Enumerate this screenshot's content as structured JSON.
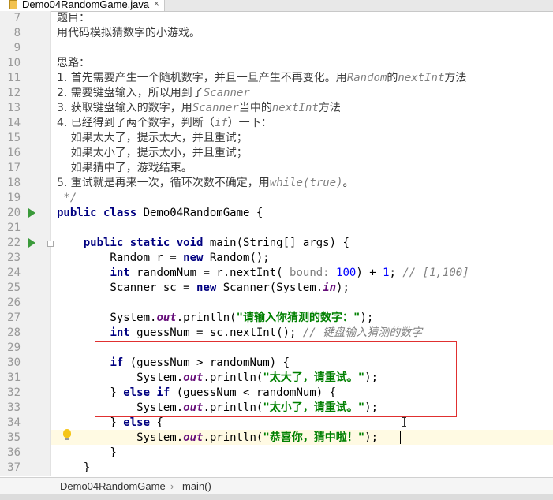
{
  "tab": {
    "label": "Demo04RandomGame.java",
    "close": "×"
  },
  "breadcrumb": {
    "class_name": "Demo04RandomGame",
    "method_name": "main()",
    "separator": "›"
  },
  "lines": [
    {
      "n": "7",
      "parts": [
        {
          "t": "题目：",
          "c": "doc"
        }
      ]
    },
    {
      "n": "8",
      "parts": [
        {
          "t": "用代码模拟猜数字的小游戏。",
          "c": "doc"
        }
      ]
    },
    {
      "n": "9",
      "parts": []
    },
    {
      "n": "10",
      "parts": [
        {
          "t": "思路：",
          "c": "doc"
        }
      ]
    },
    {
      "n": "11",
      "parts": [
        {
          "t": "1. 首先需要产生一个随机数字，并且一旦产生不再变化。用",
          "c": "doc"
        },
        {
          "t": "Random",
          "c": "comment"
        },
        {
          "t": "的",
          "c": "doc"
        },
        {
          "t": "nextInt",
          "c": "comment"
        },
        {
          "t": "方法",
          "c": "doc"
        }
      ]
    },
    {
      "n": "12",
      "parts": [
        {
          "t": "2. 需要键盘输入，所以用到了",
          "c": "doc"
        },
        {
          "t": "Scanner",
          "c": "comment"
        }
      ]
    },
    {
      "n": "13",
      "parts": [
        {
          "t": "3. 获取键盘输入的数字，用",
          "c": "doc"
        },
        {
          "t": "Scanner",
          "c": "comment"
        },
        {
          "t": "当中的",
          "c": "doc"
        },
        {
          "t": "nextInt",
          "c": "comment"
        },
        {
          "t": "方法",
          "c": "doc"
        }
      ]
    },
    {
      "n": "14",
      "parts": [
        {
          "t": "4. 已经得到了两个数字，判断（",
          "c": "doc"
        },
        {
          "t": "if",
          "c": "comment"
        },
        {
          "t": "）一下：",
          "c": "doc"
        }
      ]
    },
    {
      "n": "15",
      "parts": [
        {
          "t": "    如果太大了，提示太大，并且重试；",
          "c": "doc"
        }
      ]
    },
    {
      "n": "16",
      "parts": [
        {
          "t": "    如果太小了，提示太小，并且重试；",
          "c": "doc"
        }
      ]
    },
    {
      "n": "17",
      "parts": [
        {
          "t": "    如果猜中了，游戏结束。",
          "c": "doc"
        }
      ]
    },
    {
      "n": "18",
      "parts": [
        {
          "t": "5. 重试就是再来一次，循环次数不确定，用",
          "c": "doc"
        },
        {
          "t": "while(true)",
          "c": "comment"
        },
        {
          "t": "。",
          "c": "doc"
        }
      ]
    },
    {
      "n": "19",
      "parts": [
        {
          "t": " */",
          "c": "comment"
        }
      ]
    },
    {
      "n": "20",
      "parts": [
        {
          "t": "public class ",
          "c": "kw"
        },
        {
          "t": "Demo04RandomGame {",
          "c": ""
        }
      ]
    },
    {
      "n": "21",
      "parts": []
    },
    {
      "n": "22",
      "parts": [
        {
          "t": "    ",
          "c": ""
        },
        {
          "t": "public static void ",
          "c": "kw"
        },
        {
          "t": "main(String[] args) {",
          "c": ""
        }
      ]
    },
    {
      "n": "23",
      "parts": [
        {
          "t": "        Random r = ",
          "c": ""
        },
        {
          "t": "new ",
          "c": "kw"
        },
        {
          "t": "Random();",
          "c": ""
        }
      ]
    },
    {
      "n": "24",
      "parts": [
        {
          "t": "        ",
          "c": ""
        },
        {
          "t": "int ",
          "c": "kw"
        },
        {
          "t": "randomNum = r.nextInt( ",
          "c": ""
        },
        {
          "t": "bound: ",
          "c": "hint"
        },
        {
          "t": "100",
          "c": "num"
        },
        {
          "t": ") + ",
          "c": ""
        },
        {
          "t": "1",
          "c": "num"
        },
        {
          "t": "; ",
          "c": ""
        },
        {
          "t": "// [1,100]",
          "c": "comment"
        }
      ]
    },
    {
      "n": "25",
      "parts": [
        {
          "t": "        Scanner sc = ",
          "c": ""
        },
        {
          "t": "new ",
          "c": "kw"
        },
        {
          "t": "Scanner(System.",
          "c": ""
        },
        {
          "t": "in",
          "c": "field"
        },
        {
          "t": ");",
          "c": ""
        }
      ]
    },
    {
      "n": "26",
      "parts": []
    },
    {
      "n": "27",
      "parts": [
        {
          "t": "        System.",
          "c": ""
        },
        {
          "t": "out",
          "c": "field"
        },
        {
          "t": ".println(",
          "c": ""
        },
        {
          "t": "\"请输入你猜测的数字：\"",
          "c": "str"
        },
        {
          "t": ");",
          "c": ""
        }
      ]
    },
    {
      "n": "28",
      "parts": [
        {
          "t": "        ",
          "c": ""
        },
        {
          "t": "int ",
          "c": "kw"
        },
        {
          "t": "guessNum = sc.nextInt(); ",
          "c": ""
        },
        {
          "t": "// 键盘输入猜测的数字",
          "c": "comment"
        }
      ]
    },
    {
      "n": "29",
      "parts": []
    },
    {
      "n": "30",
      "parts": [
        {
          "t": "        ",
          "c": ""
        },
        {
          "t": "if ",
          "c": "kw"
        },
        {
          "t": "(guessNum > randomNum) {",
          "c": ""
        }
      ]
    },
    {
      "n": "31",
      "parts": [
        {
          "t": "            System.",
          "c": ""
        },
        {
          "t": "out",
          "c": "field"
        },
        {
          "t": ".println(",
          "c": ""
        },
        {
          "t": "\"太大了，请重试。\"",
          "c": "str"
        },
        {
          "t": ");",
          "c": ""
        }
      ]
    },
    {
      "n": "32",
      "parts": [
        {
          "t": "        } ",
          "c": ""
        },
        {
          "t": "else if ",
          "c": "kw"
        },
        {
          "t": "(guessNum < randomNum) {",
          "c": ""
        }
      ]
    },
    {
      "n": "33",
      "parts": [
        {
          "t": "            System.",
          "c": ""
        },
        {
          "t": "out",
          "c": "field"
        },
        {
          "t": ".println(",
          "c": ""
        },
        {
          "t": "\"太小了，请重试。\"",
          "c": "str"
        },
        {
          "t": ");",
          "c": ""
        }
      ]
    },
    {
      "n": "34",
      "parts": [
        {
          "t": "        } ",
          "c": ""
        },
        {
          "t": "else ",
          "c": "kw"
        },
        {
          "t": "{",
          "c": ""
        }
      ]
    },
    {
      "n": "35",
      "parts": [
        {
          "t": "            System.",
          "c": ""
        },
        {
          "t": "out",
          "c": "field"
        },
        {
          "t": ".println(",
          "c": ""
        },
        {
          "t": "\"恭喜你，猜中啦！\"",
          "c": "str"
        },
        {
          "t": ");",
          "c": ""
        }
      ]
    },
    {
      "n": "36",
      "parts": [
        {
          "t": "        }",
          "c": ""
        }
      ]
    },
    {
      "n": "37",
      "parts": [
        {
          "t": "    }",
          "c": ""
        }
      ]
    }
  ],
  "colors": {
    "keyword": "#000080",
    "string": "#008000",
    "comment": "#808080",
    "number": "#0000ff",
    "field": "#660e7a",
    "highlight_box": "#e03030",
    "run_icon": "#3a9a3a"
  },
  "icons": {
    "run": "run-icon",
    "fold": "fold-icon",
    "intention": "lightbulb-icon",
    "file": "java-file-icon"
  }
}
